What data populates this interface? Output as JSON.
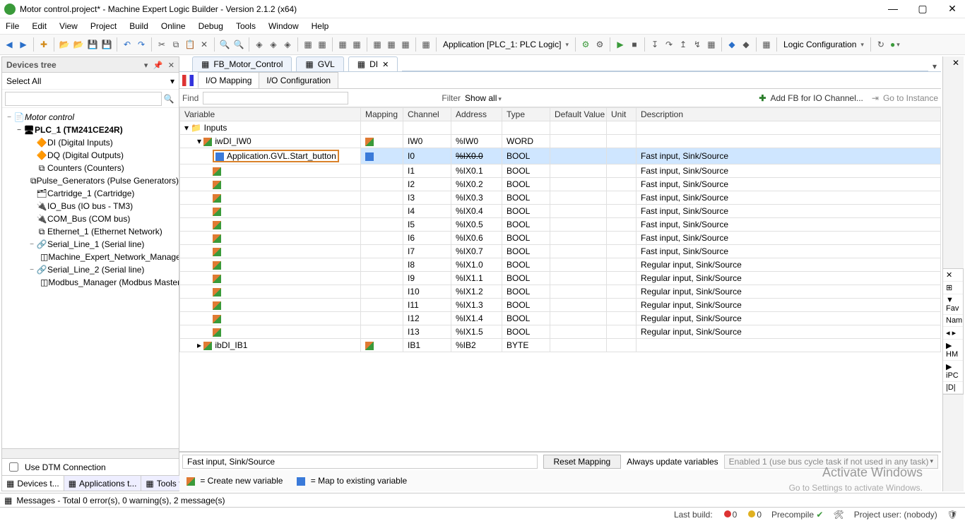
{
  "window": {
    "title": "Motor control.project* - Machine Expert Logic Builder - Version 2.1.2 (x64)"
  },
  "menu": [
    "File",
    "Edit",
    "View",
    "Project",
    "Build",
    "Online",
    "Debug",
    "Tools",
    "Window",
    "Help"
  ],
  "toolbar": {
    "app_context": "Application [PLC_1: PLC Logic]",
    "right_combo": "Logic Configuration"
  },
  "device_pane": {
    "title": "Devices tree",
    "select_all": "Select All",
    "use_dtm": "Use DTM Connection",
    "tree": [
      {
        "lvl": 0,
        "twist": "−",
        "icon": "📄",
        "label": "Motor control",
        "italic": true
      },
      {
        "lvl": 1,
        "twist": "−",
        "icon": "🖥",
        "label": "PLC_1 (TM241CE24R)",
        "bold": true
      },
      {
        "lvl": 2,
        "twist": "",
        "icon": "🔶",
        "label": "DI (Digital Inputs)"
      },
      {
        "lvl": 2,
        "twist": "",
        "icon": "🔶",
        "label": "DQ (Digital Outputs)"
      },
      {
        "lvl": 2,
        "twist": "",
        "icon": "⧉",
        "label": "Counters (Counters)"
      },
      {
        "lvl": 2,
        "twist": "",
        "icon": "⧉",
        "label": "Pulse_Generators (Pulse Generators)"
      },
      {
        "lvl": 2,
        "twist": "",
        "icon": "🗂",
        "label": "Cartridge_1 (Cartridge)"
      },
      {
        "lvl": 2,
        "twist": "",
        "icon": "🔌",
        "label": "IO_Bus (IO bus - TM3)"
      },
      {
        "lvl": 2,
        "twist": "",
        "icon": "🔌",
        "label": "COM_Bus (COM bus)"
      },
      {
        "lvl": 2,
        "twist": "",
        "icon": "⧉",
        "label": "Ethernet_1 (Ethernet Network)"
      },
      {
        "lvl": 2,
        "twist": "−",
        "icon": "🔗",
        "label": "Serial_Line_1 (Serial line)"
      },
      {
        "lvl": 3,
        "twist": "",
        "icon": "◫",
        "label": "Machine_Expert_Network_Manager"
      },
      {
        "lvl": 2,
        "twist": "−",
        "icon": "🔗",
        "label": "Serial_Line_2 (Serial line)"
      },
      {
        "lvl": 3,
        "twist": "",
        "icon": "◫",
        "label": "Modbus_Manager (Modbus Master)"
      }
    ],
    "sidetabs": [
      "Devices t...",
      "Applications t...",
      "Tools tree"
    ]
  },
  "editor": {
    "doc_tabs": [
      {
        "label": "FB_Motor_Control",
        "active": false
      },
      {
        "label": "GVL",
        "active": false
      },
      {
        "label": "DI",
        "active": true
      }
    ],
    "sub_tabs": [
      {
        "label": "I/O Mapping",
        "active": true
      },
      {
        "label": "I/O Configuration",
        "active": false
      }
    ],
    "findbar": {
      "find_label": "Find",
      "filter_label": "Filter",
      "filter_value": "Show all",
      "add_fb": "Add FB for IO Channel...",
      "go_instance": "Go to Instance"
    },
    "columns": [
      "Variable",
      "Mapping",
      "Channel",
      "Address",
      "Type",
      "Default Value",
      "Unit",
      "Description"
    ],
    "root_label": "Inputs",
    "iw_label": "iwDI_IW0",
    "ib_label": "ibDI_IB1",
    "iw_row": {
      "channel": "IW0",
      "address": "%IW0",
      "type": "WORD"
    },
    "ib_row": {
      "channel": "IB1",
      "address": "%IB2",
      "type": "BYTE"
    },
    "selected_variable": "Application.GVL.Start_button",
    "rows": [
      {
        "var": "Application.GVL.Start_button",
        "channel": "I0",
        "address": "%IX0.0",
        "type": "BOOL",
        "desc": "Fast input, Sink/Source",
        "sel": true,
        "struck": true
      },
      {
        "var": "",
        "channel": "I1",
        "address": "%IX0.1",
        "type": "BOOL",
        "desc": "Fast input, Sink/Source"
      },
      {
        "var": "",
        "channel": "I2",
        "address": "%IX0.2",
        "type": "BOOL",
        "desc": "Fast input, Sink/Source"
      },
      {
        "var": "",
        "channel": "I3",
        "address": "%IX0.3",
        "type": "BOOL",
        "desc": "Fast input, Sink/Source"
      },
      {
        "var": "",
        "channel": "I4",
        "address": "%IX0.4",
        "type": "BOOL",
        "desc": "Fast input, Sink/Source"
      },
      {
        "var": "",
        "channel": "I5",
        "address": "%IX0.5",
        "type": "BOOL",
        "desc": "Fast input, Sink/Source"
      },
      {
        "var": "",
        "channel": "I6",
        "address": "%IX0.6",
        "type": "BOOL",
        "desc": "Fast input, Sink/Source"
      },
      {
        "var": "",
        "channel": "I7",
        "address": "%IX0.7",
        "type": "BOOL",
        "desc": "Fast input, Sink/Source"
      },
      {
        "var": "",
        "channel": "I8",
        "address": "%IX1.0",
        "type": "BOOL",
        "desc": "Regular input, Sink/Source"
      },
      {
        "var": "",
        "channel": "I9",
        "address": "%IX1.1",
        "type": "BOOL",
        "desc": "Regular input, Sink/Source"
      },
      {
        "var": "",
        "channel": "I10",
        "address": "%IX1.2",
        "type": "BOOL",
        "desc": "Regular input, Sink/Source"
      },
      {
        "var": "",
        "channel": "I11",
        "address": "%IX1.3",
        "type": "BOOL",
        "desc": "Regular input, Sink/Source"
      },
      {
        "var": "",
        "channel": "I12",
        "address": "%IX1.4",
        "type": "BOOL",
        "desc": "Regular input, Sink/Source"
      },
      {
        "var": "",
        "channel": "I13",
        "address": "%IX1.5",
        "type": "BOOL",
        "desc": "Regular input, Sink/Source"
      }
    ],
    "footer": {
      "status": "Fast input, Sink/Source",
      "reset_btn": "Reset Mapping",
      "always_label": "Always update variables",
      "always_value": "Enabled 1 (use bus cycle task if not used in any task)"
    },
    "legend": {
      "create": "= Create new variable",
      "map": "= Map to existing variable"
    }
  },
  "right_dock": {
    "items": [
      "✕",
      "⊞",
      "▼ Fav",
      "Nam",
      "◂ ▸",
      "▶ HM",
      "▶ iPC",
      "|D|"
    ]
  },
  "messages_bar": "Messages - Total 0 error(s), 0 warning(s), 2 message(s)",
  "status": {
    "last_build": "Last build:",
    "err": "0",
    "warn": "0",
    "precompile": "Precompile",
    "project_user": "Project user: (nobody)"
  },
  "watermark": {
    "l1": "Activate Windows",
    "l2": "Go to Settings to activate Windows."
  }
}
